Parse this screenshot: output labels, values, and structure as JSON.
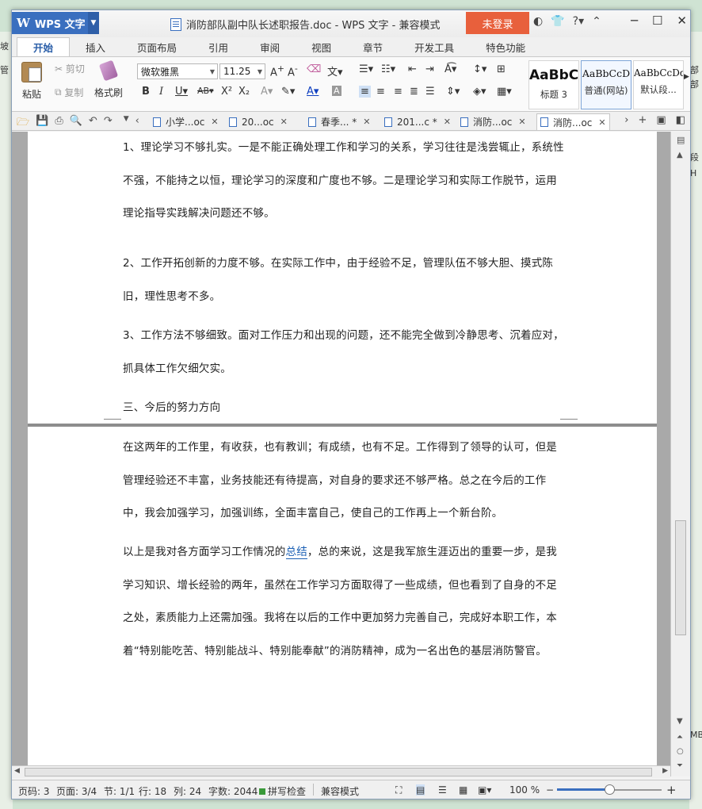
{
  "desktop": {
    "left_labels": [
      "坡",
      "管"
    ],
    "right_labels": [
      "部",
      "部",
      "段",
      "H",
      "MB"
    ]
  },
  "titlebar": {
    "app_name": "WPS 文字",
    "doc_title": "消防部队副中队长述职报告.doc - WPS 文字 - 兼容模式",
    "login_label": "未登录"
  },
  "tabs": [
    "开始",
    "插入",
    "页面布局",
    "引用",
    "审阅",
    "视图",
    "章节",
    "开发工具",
    "特色功能"
  ],
  "active_tab": "开始",
  "ribbon": {
    "paste_label": "粘贴",
    "cut_label": "剪切",
    "copy_label": "复制",
    "format_painter_label": "格式刷",
    "font_name": "微软雅黑",
    "font_size": "11.25",
    "styles": [
      {
        "sample": "AaBbC",
        "caption": "标题 3"
      },
      {
        "sample": "AaBbCcD",
        "caption": "普通(网站)"
      },
      {
        "sample": "AaBbCcDd",
        "caption": "默认段..."
      }
    ]
  },
  "doc_tabs": [
    {
      "label": "小学...oc"
    },
    {
      "label": "20...oc"
    },
    {
      "label": "春季... *"
    },
    {
      "label": "201...c *"
    },
    {
      "label": "消防...oc"
    },
    {
      "label": "消防...oc"
    }
  ],
  "document": {
    "page1_paragraphs": [
      "1、理论学习不够扎实。一是不能正确处理工作和学习的关系，学习往往是浅尝辄止，系统性不强，不能持之以恒，理论学习的深度和广度也不够。二是理论学习和实际工作脱节，运用理论指导实践解决问题还不够。",
      "2、工作开拓创新的力度不够。在实际工作中，由于经验不足，管理队伍不够大胆、摸式陈旧，理性思考不多。",
      "3、工作方法不够细致。面对工作压力和出现的问题，还不能完全做到冷静思考、沉着应对，抓具体工作欠细欠实。",
      "三、今后的努力方向"
    ],
    "page2_para1": "在这两年的工作里，有收获，也有教训；有成绩，也有不足。工作得到了领导的认可，但是管理经验还不丰富，业务技能还有待提高，对自身的要求还不够严格。总之在今后的工作中，我会加强学习，加强训练，全面丰富自己，使自己的工作再上一个新台阶。",
    "page2_para2_before": "以上是我对各方面学习工作情况的",
    "page2_para2_link": "总结",
    "page2_para2_after": "，总的来说，这是我军旅生涯迈出的重要一步，是我学习知识、增长经验的两年，虽然在工作学习方面取得了一些成绩，但也看到了自身的不足之处，素质能力上还需加强。我将在以后的工作中更加努力完善自己，完成好本职工作，本着“特别能吃苦、特别能战斗、特别能奉献”的消防精神，成为一名出色的基层消防警官。"
  },
  "statusbar": {
    "page_code": "页码: 3",
    "page": "页面: 3/4",
    "section": "节: 1/1",
    "row": "行: 18",
    "col": "列: 24",
    "word_count": "字数: 2044",
    "spellcheck": "拼写检查",
    "compat_mode": "兼容模式",
    "zoom": "100 %"
  }
}
